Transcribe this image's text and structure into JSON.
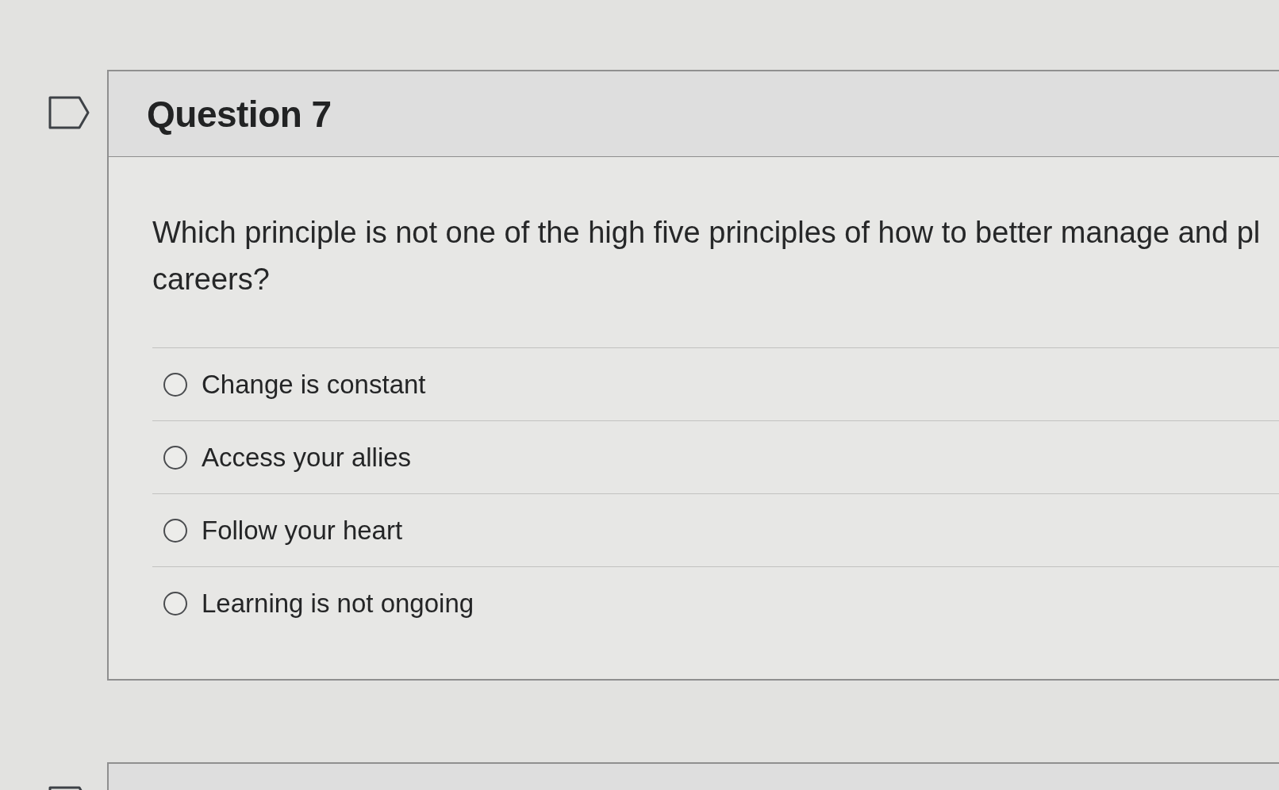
{
  "questions": [
    {
      "kind": "full",
      "title": "Question 7",
      "prompt_lines": [
        "Which principle is not one of the high five principles of how to better manage and pl",
        "careers?"
      ],
      "options": [
        {
          "label": "Change is constant",
          "selected": false
        },
        {
          "label": "Access your allies",
          "selected": false
        },
        {
          "label": "Follow your heart",
          "selected": false
        },
        {
          "label": "Learning is not ongoing",
          "selected": false
        }
      ]
    },
    {
      "kind": "peek"
    }
  ]
}
